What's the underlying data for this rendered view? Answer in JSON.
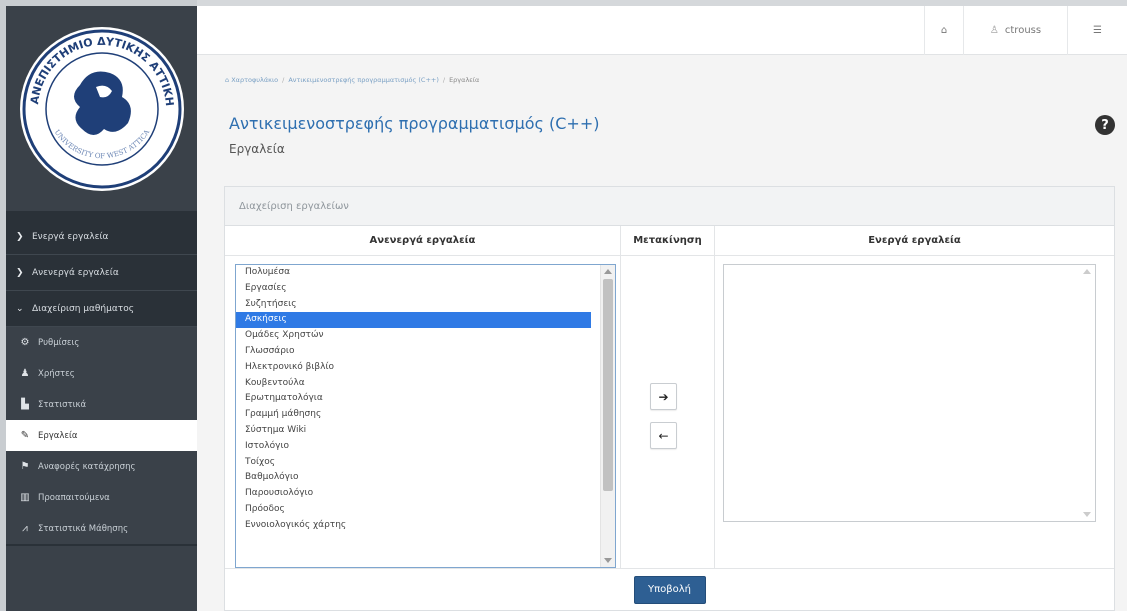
{
  "sidebar": {
    "logo_text": "ΠΑΝΕΠΙΣΤΗΜΙΟ ΔΥΤΙΚΗΣ ΑΤΤΙΚΗΣ · UNIVERSITY OF WEST ATTICA",
    "sections": [
      {
        "label": "Ενεργά εργαλεία",
        "icon": "chevron-right-icon",
        "chev": "❯"
      },
      {
        "label": "Ανενεργά εργαλεία",
        "icon": "chevron-right-icon",
        "chev": "❯"
      },
      {
        "label": "Διαχείριση μαθήματος",
        "icon": "chevron-down-icon",
        "chev": "⌄"
      }
    ],
    "items": [
      {
        "label": "Ρυθμίσεις",
        "icon": "cogs-icon",
        "glyph": "⚙"
      },
      {
        "label": "Χρήστες",
        "icon": "user-icon",
        "glyph": "♟"
      },
      {
        "label": "Στατιστικά",
        "icon": "bar-chart-icon",
        "glyph": "▙"
      },
      {
        "label": "Εργαλεία",
        "icon": "wrench-icon",
        "glyph": "✎"
      },
      {
        "label": "Αναφορές κατάχρησης",
        "icon": "flag-icon",
        "glyph": "⚑"
      },
      {
        "label": "Προαπαιτούμενα",
        "icon": "bank-icon",
        "glyph": "▥"
      },
      {
        "label": "Στατιστικά Μάθησης",
        "icon": "line-chart-icon",
        "glyph": "⩘"
      }
    ],
    "active_item": "Εργαλεία"
  },
  "topbar": {
    "home_glyph": "⌂",
    "username": "ctrouss",
    "user_glyph": "♙",
    "settings_glyph": "☰"
  },
  "breadcrumb": {
    "home": "Χαρτοφυλάκιο",
    "course": "Αντικειμενοστρεφής προγραμματισμός (C++)",
    "current": "Εργαλεία",
    "separator": "/"
  },
  "header": {
    "course_title": "Αντικειμενοστρεφής προγραμματισμός (C++)",
    "page_subtitle": "Εργαλεία",
    "help_glyph": "?"
  },
  "panel": {
    "title": "Διαχείριση εργαλείων",
    "columns": {
      "inactive": "Ανενεργά εργαλεία",
      "move": "Μετακίνηση",
      "active": "Ενεργά εργαλεία"
    },
    "inactive_tools": [
      "Πολυμέσα",
      "Εργασίες",
      "Συζητήσεις",
      "Ασκήσεις",
      "Ομάδες Χρηστών",
      "Γλωσσάριο",
      "Ηλεκτρονικό βιβλίο",
      "Κουβεντούλα",
      "Ερωτηματολόγια",
      "Γραμμή μάθησης",
      "Σύστημα Wiki",
      "Ιστολόγιο",
      "Τοίχος",
      "Βαθμολόγιο",
      "Παρουσιολόγιο",
      "Πρόοδος",
      "Εννοιολογικός χάρτης"
    ],
    "selected_tool": "Ασκήσεις",
    "active_tools": [],
    "move_right_glyph": "➔",
    "move_left_glyph": "🡐",
    "submit_label": "Υποβολή"
  },
  "colors": {
    "sidebar_bg": "#2a3138",
    "accent_blue": "#2e6fb0",
    "selection": "#2f7ae5",
    "submit_bg": "#2e5f93"
  }
}
